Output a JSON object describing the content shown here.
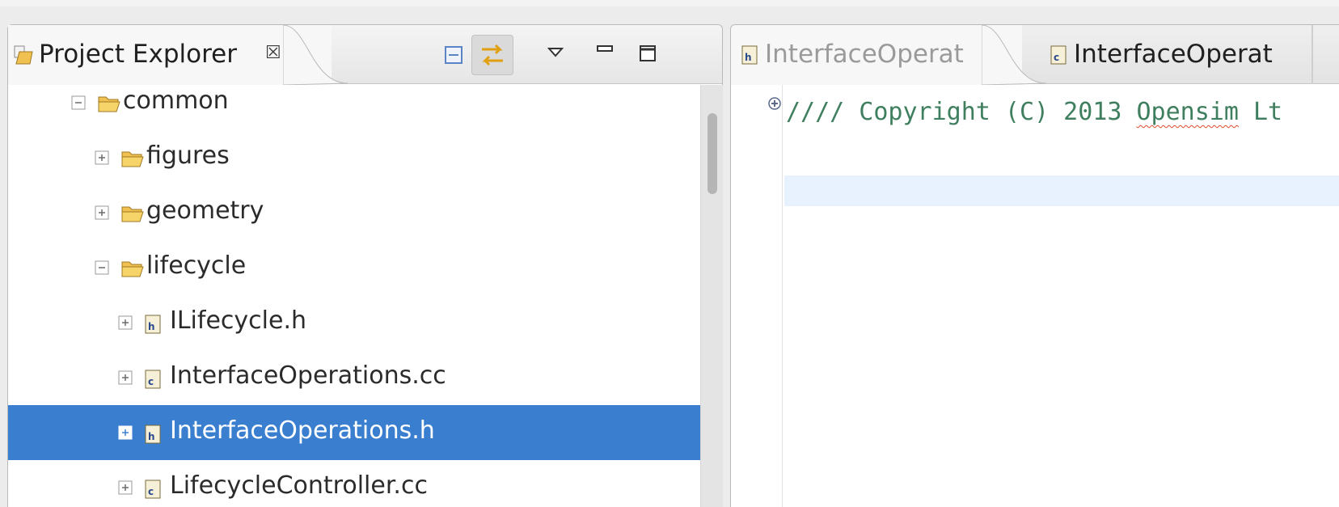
{
  "project_explorer": {
    "title": "Project Explorer",
    "close_glyph": "☒",
    "toolbar": {
      "collapse_all_icon": "collapse-all-icon",
      "link_with_editor_icon": "link-with-editor-icon",
      "view_menu_icon": "view-menu-icon",
      "minimize_icon": "minimize-icon",
      "maximize_icon": "maximize-icon"
    },
    "tree": [
      {
        "label": "common",
        "kind": "folder",
        "expanded": true,
        "depth": 0,
        "selected": false
      },
      {
        "label": "figures",
        "kind": "folder",
        "expanded": false,
        "depth": 1,
        "selected": false
      },
      {
        "label": "geometry",
        "kind": "folder",
        "expanded": false,
        "depth": 1,
        "selected": false
      },
      {
        "label": "lifecycle",
        "kind": "folder",
        "expanded": true,
        "depth": 1,
        "selected": false
      },
      {
        "label": "ILifecycle.h",
        "kind": "header",
        "expanded": false,
        "depth": 2,
        "selected": false
      },
      {
        "label": "InterfaceOperations.cc",
        "kind": "source",
        "expanded": false,
        "depth": 2,
        "selected": false
      },
      {
        "label": "InterfaceOperations.h",
        "kind": "header",
        "expanded": false,
        "depth": 2,
        "selected": true
      },
      {
        "label": "LifecycleController.cc",
        "kind": "source",
        "expanded": false,
        "depth": 2,
        "selected": false
      }
    ]
  },
  "editor": {
    "tabs": [
      {
        "title": "InterfaceOperat",
        "kind": "header",
        "active": true,
        "close_glyph": "☒"
      },
      {
        "title": "InterfaceOperat",
        "kind": "source",
        "active": false
      }
    ],
    "code": {
      "line1_prefix": "//// Copyright (C) 2013 ",
      "line1_word": "Opensim",
      "line1_suffix": " Lt"
    }
  },
  "colors": {
    "selection": "#3a7fcf",
    "comment": "#3f7f5f",
    "current_line": "#e8f2fe"
  }
}
